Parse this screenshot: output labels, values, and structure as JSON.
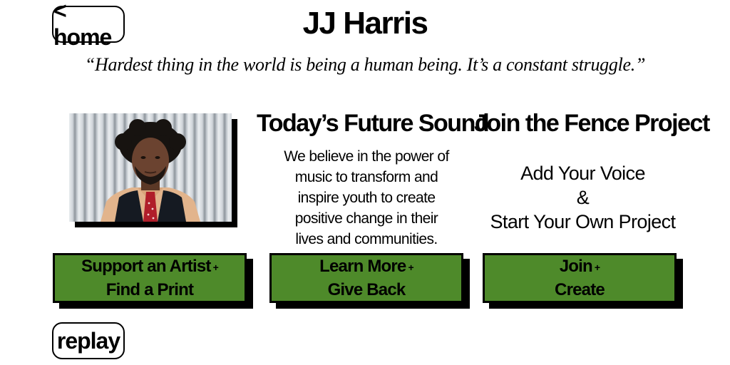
{
  "nav": {
    "home_label": "< home",
    "replay_label": "replay"
  },
  "header": {
    "title": "JJ Harris",
    "quote": "“Hardest thing in the world is being a human being. It’s a constant struggle.”"
  },
  "columns": {
    "artist": {
      "photo_icon": "portrait-photo",
      "button_line1": "Support an Artist",
      "button_plus": "+",
      "button_line2": "Find a Print"
    },
    "future_sound": {
      "heading": "Today’s Future Sound",
      "body": [
        "We believe in the power of",
        "music to transform and",
        "inspire youth to create",
        "positive change in their",
        "lives and communities."
      ],
      "button_line1": "Learn More",
      "button_plus": "+",
      "button_line2": "Give Back"
    },
    "fence_project": {
      "heading": "Join the Fence Project",
      "body": [
        "Add Your Voice",
        "&",
        "Start Your Own Project"
      ],
      "button_line1": "Join",
      "button_plus": "+",
      "button_line2": "Create"
    }
  },
  "colors": {
    "button_green": "#4e8a2a",
    "shadow": "#000000",
    "background": "#ffffff"
  }
}
